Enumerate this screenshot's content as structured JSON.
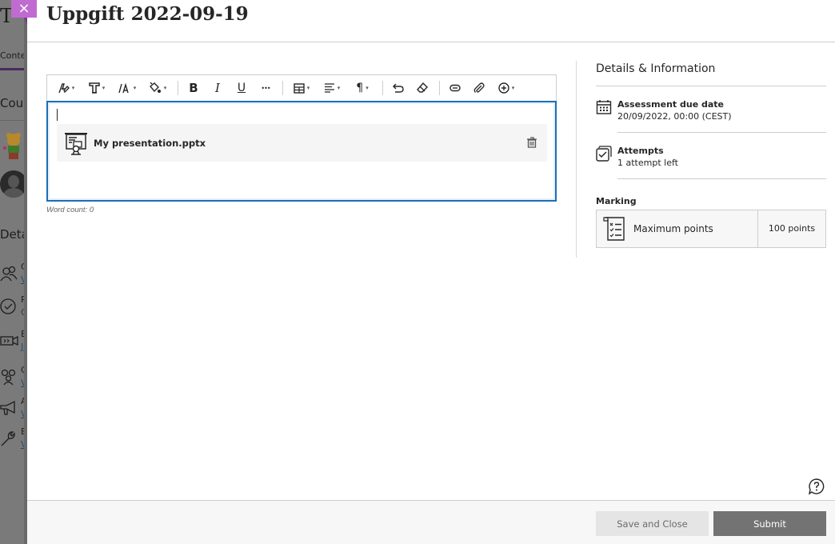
{
  "background_page": {
    "title_fragment": "T",
    "tab_fragment": "Conten",
    "course_fragment": "Cour",
    "details_fragment": "Deta",
    "items": [
      {
        "icon": "people-icon",
        "line1": "C",
        "line2": "V"
      },
      {
        "icon": "check-circle-icon",
        "line1": "P",
        "line2": "O"
      },
      {
        "icon": "video-camera-icon",
        "line1": "B",
        "line2": "Jo"
      },
      {
        "icon": "group-icon",
        "line1": "G",
        "line2": "V"
      },
      {
        "icon": "megaphone-icon",
        "line1": "A",
        "line2": "V"
      },
      {
        "icon": "wrench-icon",
        "line1": "B",
        "line2": "V"
      }
    ]
  },
  "panel": {
    "close_icon": "×",
    "title": "Uppgift 2022-09-19"
  },
  "editor": {
    "toolbar": [
      {
        "name": "paragraph-style",
        "icon": "pen-style-icon",
        "dropdown": true
      },
      {
        "name": "text-format",
        "icon": "text-format-icon",
        "dropdown": true
      },
      {
        "name": "font-size",
        "icon": "font-size-icon",
        "dropdown": true
      },
      {
        "name": "text-color",
        "icon": "paint-bucket-icon",
        "dropdown": true
      },
      {
        "name": "bold",
        "icon": "bold-icon",
        "glyph": "B"
      },
      {
        "name": "italic",
        "icon": "italic-icon",
        "glyph": "I"
      },
      {
        "name": "underline",
        "icon": "underline-icon",
        "glyph": "U"
      },
      {
        "name": "more",
        "icon": "more-icon",
        "glyph": "•••"
      },
      {
        "name": "table",
        "icon": "table-icon",
        "dropdown": true
      },
      {
        "name": "align",
        "icon": "align-icon",
        "dropdown": true
      },
      {
        "name": "paragraph",
        "icon": "pilcrow-icon",
        "glyph": "¶",
        "dropdown": true
      },
      {
        "name": "undo",
        "icon": "undo-icon"
      },
      {
        "name": "clear-format",
        "icon": "eraser-icon"
      },
      {
        "name": "link",
        "icon": "link-icon"
      },
      {
        "name": "attach",
        "icon": "paperclip-icon"
      },
      {
        "name": "insert",
        "icon": "plus-circle-icon",
        "dropdown": true
      }
    ],
    "attachment": {
      "icon": "presentation-icon",
      "file_name": "My presentation.pptx",
      "delete_icon": "trash-icon"
    },
    "word_count": "Word count: 0"
  },
  "details": {
    "title": "Details & Information",
    "due_date": {
      "icon": "calendar-icon",
      "label": "Assessment due date",
      "value": "20/09/2022, 00:00 (CEST)"
    },
    "attempts": {
      "icon": "checkbox-stack-icon",
      "label": "Attempts",
      "value": "1 attempt left"
    },
    "marking": {
      "label": "Marking",
      "icon": "checklist-icon",
      "item_label": "Maximum points",
      "item_value": "100 points"
    }
  },
  "help": {
    "icon": "help-bubble-icon"
  },
  "footer": {
    "save_label": "Save and Close",
    "submit_label": "Submit"
  },
  "colors": {
    "close_accent": "#c06bd0",
    "editor_focus": "#1b6fb5",
    "submit_bg": "#737373",
    "save_bg": "#e5e5e5"
  }
}
